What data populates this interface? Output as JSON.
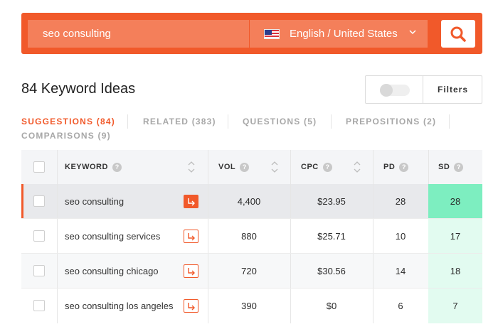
{
  "search": {
    "keyword_value": "seo consulting",
    "locale_label": "English / United States",
    "locale_flag": "us-flag-icon",
    "search_icon": "search-icon"
  },
  "heading": {
    "title": "84 Keyword Ideas",
    "filters_label": "Filters",
    "toggle_on": false
  },
  "tabs": [
    {
      "label": "SUGGESTIONS (84)",
      "active": true
    },
    {
      "label": "RELATED (383)",
      "active": false
    },
    {
      "label": "QUESTIONS (5)",
      "active": false
    },
    {
      "label": "PREPOSITIONS (2)",
      "active": false
    },
    {
      "label": "COMPARISONS (9)",
      "active": false
    }
  ],
  "table": {
    "headers": {
      "keyword": "KEYWORD",
      "vol": "VOL",
      "cpc": "CPC",
      "pd": "PD",
      "sd": "SD",
      "help": "?"
    },
    "rows": [
      {
        "keyword": "seo consulting",
        "vol": "4,400",
        "cpc": "$23.95",
        "pd": "28",
        "sd": "28",
        "selected": true
      },
      {
        "keyword": "seo consulting services",
        "vol": "880",
        "cpc": "$25.71",
        "pd": "10",
        "sd": "17",
        "selected": false
      },
      {
        "keyword": "seo consulting chicago",
        "vol": "720",
        "cpc": "$30.56",
        "pd": "14",
        "sd": "18",
        "selected": false
      },
      {
        "keyword": "seo consulting los angeles",
        "vol": "390",
        "cpc": "$0",
        "pd": "6",
        "sd": "7",
        "selected": false
      }
    ]
  },
  "colors": {
    "accent": "#f1592a",
    "sd_strong": "#7deec0",
    "sd_light": "#e2fbf0",
    "row_selected": "#e8e9ec",
    "row_alt": "#f7f8f9"
  }
}
